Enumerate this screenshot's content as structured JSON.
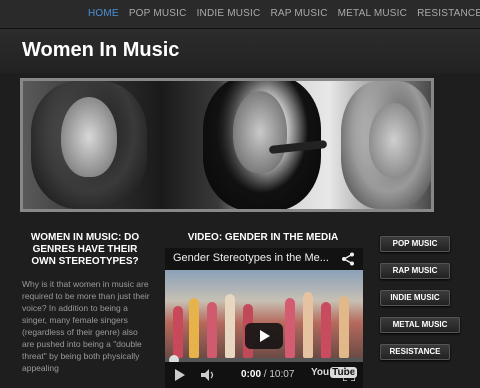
{
  "nav": {
    "items": [
      {
        "label": "HOME",
        "active": true
      },
      {
        "label": "POP MUSIC",
        "active": false
      },
      {
        "label": "INDIE MUSIC",
        "active": false
      },
      {
        "label": "RAP MUSIC",
        "active": false
      },
      {
        "label": "METAL MUSIC",
        "active": false
      },
      {
        "label": "RESISTANCE",
        "active": false
      }
    ]
  },
  "header": {
    "title": "Women In Music"
  },
  "article": {
    "title": "WOMEN IN MUSIC: DO GENRES HAVE THEIR OWN STEREOTYPES?",
    "body": "Why is it that women in music are required to be more than just their voice? In addition to being a singer, many female singers (regardless of their genre) also are pushed into being a \"double threat\" by being both physically appealing"
  },
  "video": {
    "heading": "VIDEO: GENDER IN THE MEDIA",
    "title": "Gender Stereotypes in the Me...",
    "current_time": "0:00",
    "duration": "/ 10:07",
    "logo_text": "You",
    "logo_tube": "Tube",
    "progress": 0
  },
  "sidebar": {
    "buttons": [
      {
        "label": "POP MUSIC"
      },
      {
        "label": "RAP MUSIC"
      },
      {
        "label": "INDIE MUSIC"
      },
      {
        "label": "METAL MUSIC"
      },
      {
        "label": "RESISTANCE"
      }
    ]
  },
  "colors": {
    "accent": "#4a90d9",
    "background": "#1e1e1e"
  }
}
